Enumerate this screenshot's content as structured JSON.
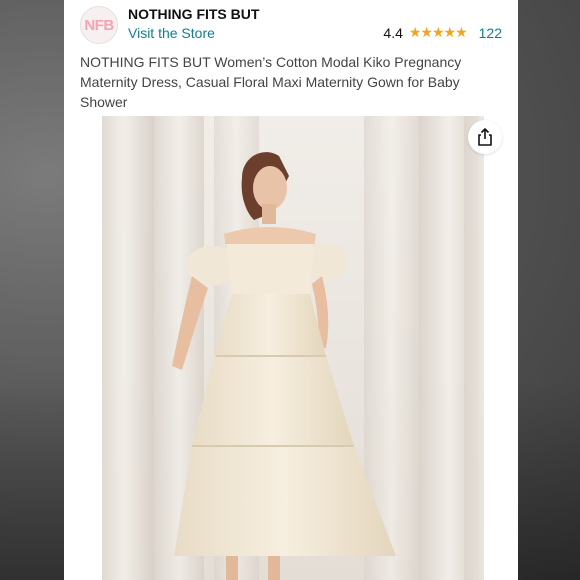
{
  "brand": {
    "logo_text": "NFB",
    "name": "NOTHING FITS BUT",
    "store_link": "Visit the Store"
  },
  "rating": {
    "value": "4.4",
    "stars": "★★★★★",
    "star_fraction": 0.88,
    "review_count": "122"
  },
  "product": {
    "title": "NOTHING FITS BUT Women’s Cotton Modal Kiko Pregnancy Maternity Dress, Casual Floral Maxi Maternity Gown for Baby Shower"
  },
  "icons": {
    "share": "share-icon"
  },
  "colors": {
    "link": "#0f7f8f",
    "star": "#f0a520",
    "logo_text": "#f4a3b3"
  }
}
